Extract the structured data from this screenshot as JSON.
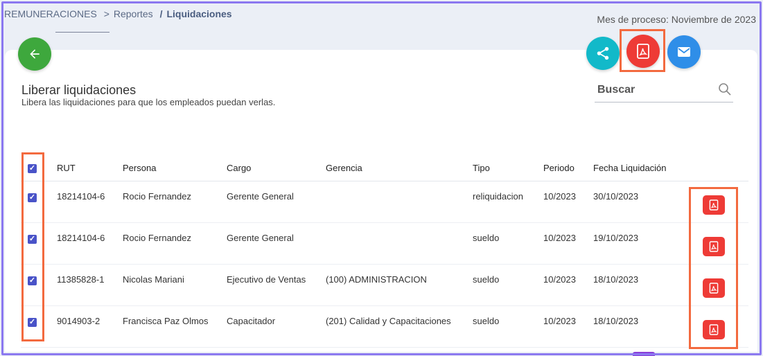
{
  "breadcrumb": {
    "root": "REMUNERACIONES",
    "sep1": ">",
    "middle": "Reportes",
    "sep2": "/",
    "current": "Liquidaciones"
  },
  "process": {
    "label": "Mes de proceso: Noviembre de 2023"
  },
  "section": {
    "title": "Liberar liquidaciones",
    "subtitle": "Libera las liquidaciones para que los empleados puedan verlas."
  },
  "search": {
    "label": "Buscar"
  },
  "table": {
    "headers": {
      "rut": "RUT",
      "persona": "Persona",
      "cargo": "Cargo",
      "gerencia": "Gerencia",
      "tipo": "Tipo",
      "periodo": "Periodo",
      "fecha": "Fecha Liquidación"
    },
    "rows": [
      {
        "rut": "18214104-6",
        "persona": "Rocio Fernandez",
        "cargo": "Gerente General",
        "gerencia": "",
        "tipo": "reliquidacion",
        "periodo": "10/2023",
        "fecha": "30/10/2023"
      },
      {
        "rut": "18214104-6",
        "persona": "Rocio Fernandez",
        "cargo": "Gerente General",
        "gerencia": "",
        "tipo": "sueldo",
        "periodo": "10/2023",
        "fecha": "19/10/2023"
      },
      {
        "rut": "11385828-1",
        "persona": "Nicolas Mariani",
        "cargo": "Ejecutivo de Ventas",
        "gerencia": "(100) ADMINISTRACION",
        "tipo": "sueldo",
        "periodo": "10/2023",
        "fecha": "18/10/2023"
      },
      {
        "rut": "9014903-2",
        "persona": "Francisca Paz Olmos",
        "cargo": "Capacitador",
        "gerencia": "(201) Calidad y Capacitaciones",
        "tipo": "sueldo",
        "periodo": "10/2023",
        "fecha": "18/10/2023"
      }
    ]
  },
  "icons": {
    "back": "arrow-left-icon",
    "share": "share-icon",
    "pdf": "pdf-file-icon",
    "mail": "mail-icon",
    "search": "search-icon",
    "checkbox": "checkmark-icon"
  },
  "colors": {
    "accent": "#4953c8",
    "back": "#3ea83d",
    "share": "#12b9c9",
    "pdf": "#ee3b36",
    "mail": "#2f8ee8",
    "highlight": "#f36a3f",
    "frame": "#8b78f0"
  }
}
